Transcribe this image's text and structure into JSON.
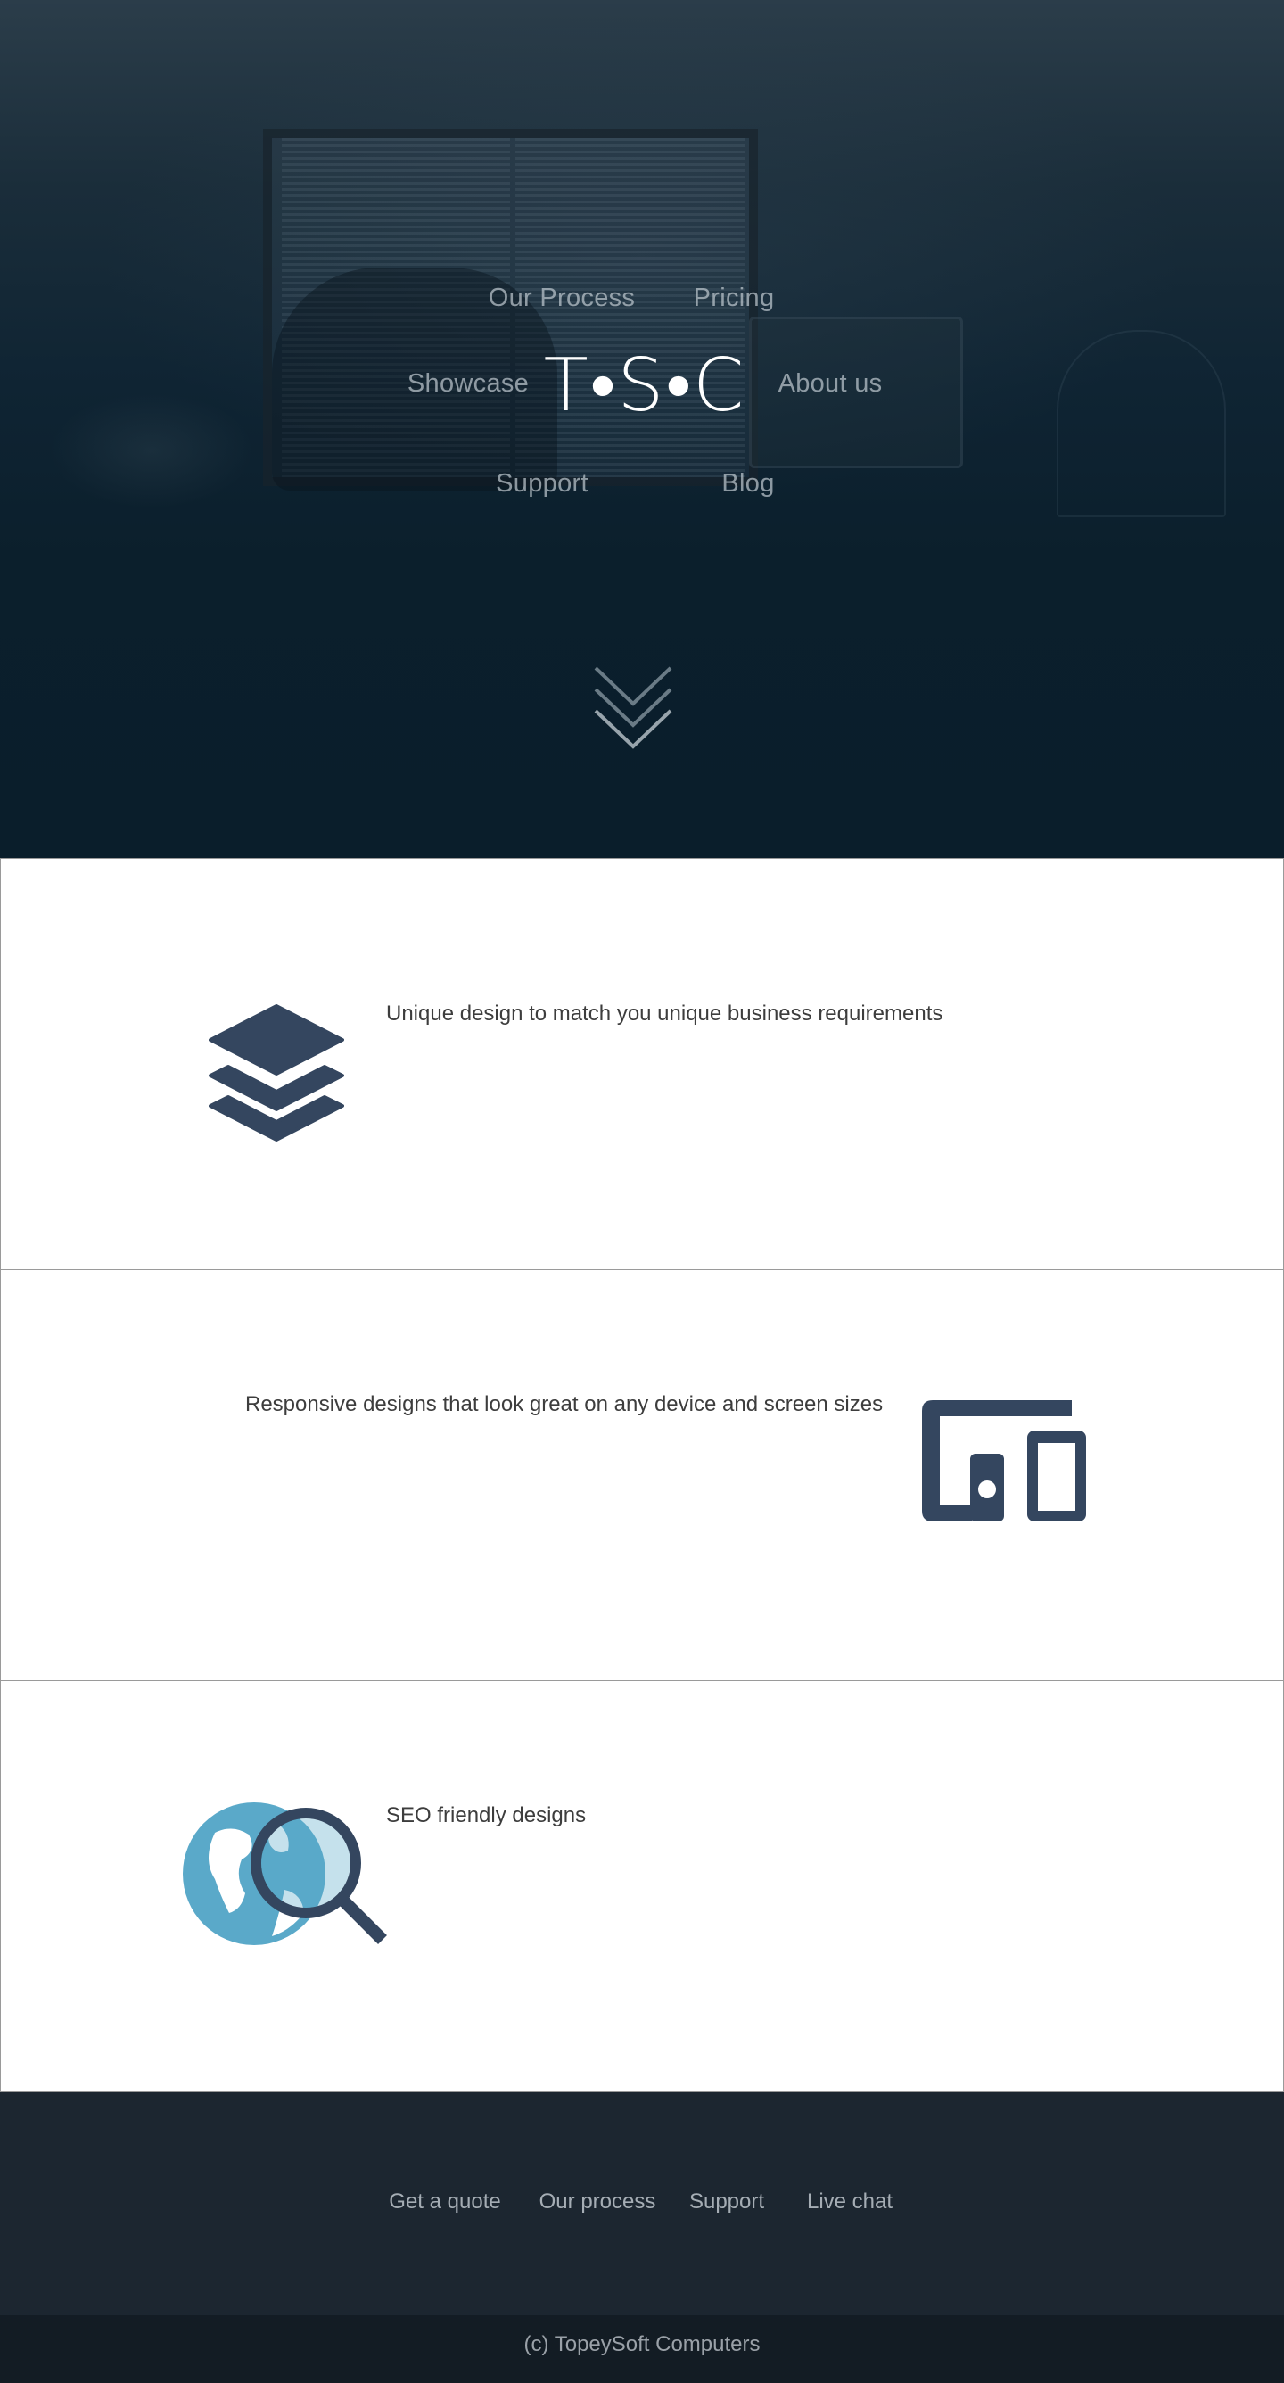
{
  "hero": {
    "logo": "T•S•C",
    "nav": {
      "our_process": "Our Process",
      "pricing": "Pricing",
      "showcase": "Showcase",
      "about_us": "About us",
      "support": "Support",
      "blog": "Blog"
    },
    "scroll_icon": "double-chevron-down-icon"
  },
  "features": [
    {
      "text": "Unique design to match you unique business requirements",
      "icon": "layers-icon",
      "icon_color": "#34465f"
    },
    {
      "text": "Responsive designs that look great on any device and screen sizes",
      "icon": "devices-icon",
      "icon_color": "#34465f"
    },
    {
      "text": "SEO friendly designs",
      "icon": "globe-search-icon",
      "icon_color": "#5aa9c9"
    }
  ],
  "footer": {
    "links": [
      "Get a quote",
      "Our process",
      "Support",
      "Live chat"
    ],
    "copyright": "(c) TopeySoft Computers"
  },
  "colors": {
    "hero_dark": "#0b1f2c",
    "icon_navy": "#34465f",
    "icon_blue": "#5aa9c9",
    "footer_bg": "#1c2630",
    "copyright_bg": "#131c24"
  }
}
